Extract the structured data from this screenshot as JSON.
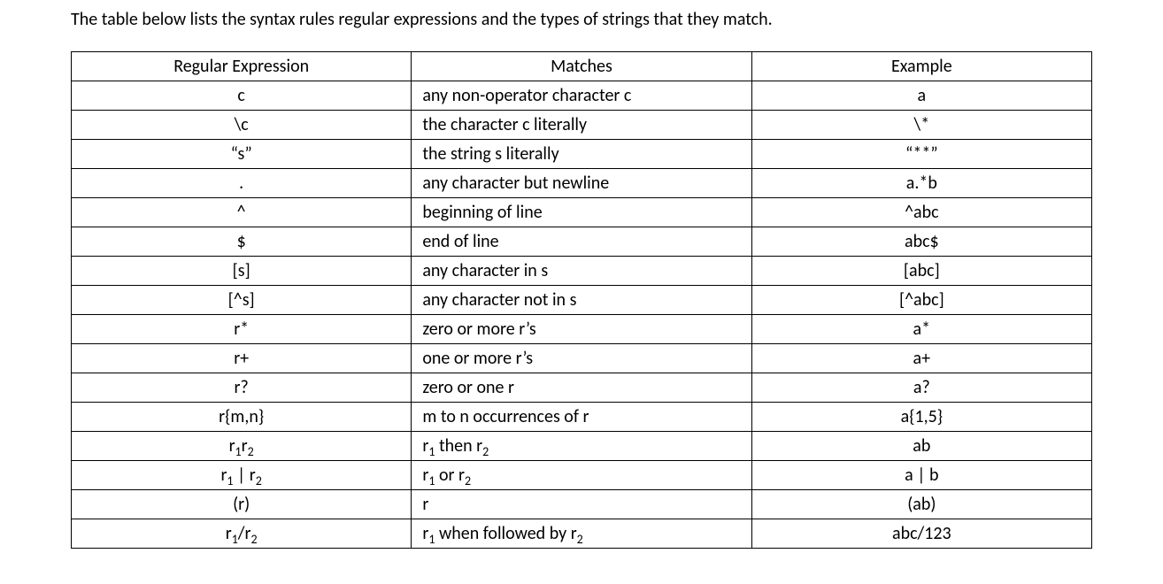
{
  "caption": "The table below lists the syntax rules regular expressions and the types of strings that they match.",
  "headers": {
    "expr": "Regular Expression",
    "matches": "Matches",
    "example": "Example"
  },
  "rows": [
    {
      "expr": "c",
      "matches": "any non-operator character c",
      "example": "a"
    },
    {
      "expr": "\\c",
      "matches": "the character c literally",
      "example": "\\*"
    },
    {
      "expr": "“s”",
      "matches": "the string s literally",
      "example": "“**”"
    },
    {
      "expr": ".",
      "matches": "any character but newline",
      "example": "a.*b"
    },
    {
      "expr": "^",
      "matches": "beginning of line",
      "example": "^abc"
    },
    {
      "expr": "$",
      "matches": "end of line",
      "example": "abc$"
    },
    {
      "expr": "[s]",
      "matches": "any character in s",
      "example": "[abc]"
    },
    {
      "expr": "[^s]",
      "matches": "any character not in s",
      "example": "[^abc]"
    },
    {
      "expr": "r*",
      "matches": "zero or more r’s",
      "example": "a*"
    },
    {
      "expr": "r+",
      "matches": "one or more r’s",
      "example": "a+"
    },
    {
      "expr": "r?",
      "matches": "zero or one r",
      "example": "a?"
    },
    {
      "expr": "r{m,n}",
      "matches": "m to n occurrences of r",
      "example": "a{1,5}"
    },
    {
      "expr_html": "r<span class=\"sub\">1</span>r<span class=\"sub\">2</span>",
      "matches_html": "r<span class=\"sub\">1</span> then r<span class=\"sub\">2</span>",
      "example": "ab"
    },
    {
      "expr_html": "r<span class=\"sub\">1</span> | r<span class=\"sub\">2</span>",
      "matches_html": "r<span class=\"sub\">1</span> or r<span class=\"sub\">2</span>",
      "example": "a | b"
    },
    {
      "expr": "(r)",
      "matches": "r",
      "example": "(ab)"
    },
    {
      "expr_html": "r<span class=\"sub\">1</span>/r<span class=\"sub\">2</span>",
      "matches_html": "r<span class=\"sub\">1</span> when followed by r<span class=\"sub\">2</span>",
      "example": "abc/123"
    }
  ]
}
